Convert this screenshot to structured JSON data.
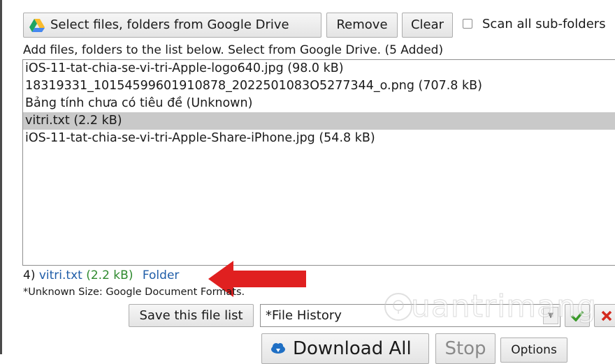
{
  "toolbar": {
    "google_drive_label": "Select files, folders from Google Drive",
    "remove_label": "Remove",
    "clear_label": "Clear",
    "scan_label": "Scan all sub-folders",
    "scan_checked": false
  },
  "add_text": "Add files, folders to the list below. Select from Google Drive. (5 Added)",
  "files": [
    {
      "label": "iOS-11-tat-chia-se-vi-tri-Apple-logo640.jpg (98.0 kB)",
      "selected": false
    },
    {
      "label": "18319331_10154599601910878_2022501083O5277344_o.png (707.8 kB)",
      "selected": false
    },
    {
      "label": "Bảng tính chưa có tiêu đề (Unknown)",
      "selected": false
    },
    {
      "label": "vitri.txt (2.2 kB)",
      "selected": true
    },
    {
      "label": "iOS-11-tat-chia-se-vi-tri-Apple-Share-iPhone.jpg (54.8 kB)",
      "selected": false
    }
  ],
  "status": {
    "index": "4)",
    "file": "vitri.txt",
    "size": "(2.2 kB)",
    "folder": "Folder"
  },
  "unknown_note": "*Unknown Size: Google Document Formats.",
  "save_list_label": "Save this file list",
  "history_value": "*File History",
  "download_label": "Download All",
  "stop_label": "Stop",
  "options_label": "Options",
  "watermark": "uantrimang",
  "colors": {
    "selected_row": "#c9c9c9",
    "link_blue": "#1f5da8",
    "size_green": "#2f8a2f",
    "arrow_red": "#e02020",
    "check_green": "#3a9a2a",
    "x_red": "#d42a1e"
  },
  "icons": [
    "google-drive-icon",
    "cloud-download-icon",
    "checkmark-icon",
    "close-icon",
    "chevron-down-icon",
    "red-arrow"
  ]
}
